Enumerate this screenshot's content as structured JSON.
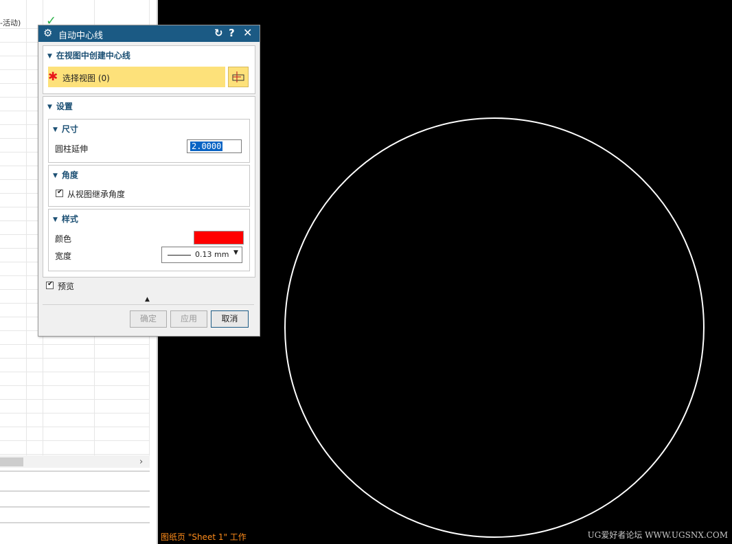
{
  "navigator": {
    "active_text": "-活动)",
    "check_symbol": "✓",
    "scroll_arrow": "›"
  },
  "canvas": {
    "sheet_label": "图纸页 \"Sheet 1\" 工作",
    "watermark": "UG爱好者论坛 WWW.UGSNX.COM",
    "background": "#000000",
    "circle_color": "#ffffff"
  },
  "dialog": {
    "title": "自动中心线",
    "icons": {
      "gear": "gear-icon",
      "reset": "reset-icon",
      "help": "help-icon",
      "close": "close-icon"
    },
    "section_create": {
      "header": "在视图中创建中心线",
      "select_label": "选择视图 (0)"
    },
    "section_settings": {
      "header": "设置",
      "dimension": {
        "header": "尺寸",
        "cylinder_label": "圆柱延伸",
        "cylinder_value": "2.0000"
      },
      "angle": {
        "header": "角度",
        "inherit_label": "从视图继承角度",
        "inherit_checked": true
      },
      "style": {
        "header": "样式",
        "color_label": "颜色",
        "color_value": "#ff0000",
        "width_label": "宽度",
        "width_value": "0.13 mm"
      }
    },
    "preview": {
      "label": "预览",
      "checked": true
    },
    "buttons": {
      "ok": "确定",
      "apply": "应用",
      "cancel": "取消"
    }
  }
}
